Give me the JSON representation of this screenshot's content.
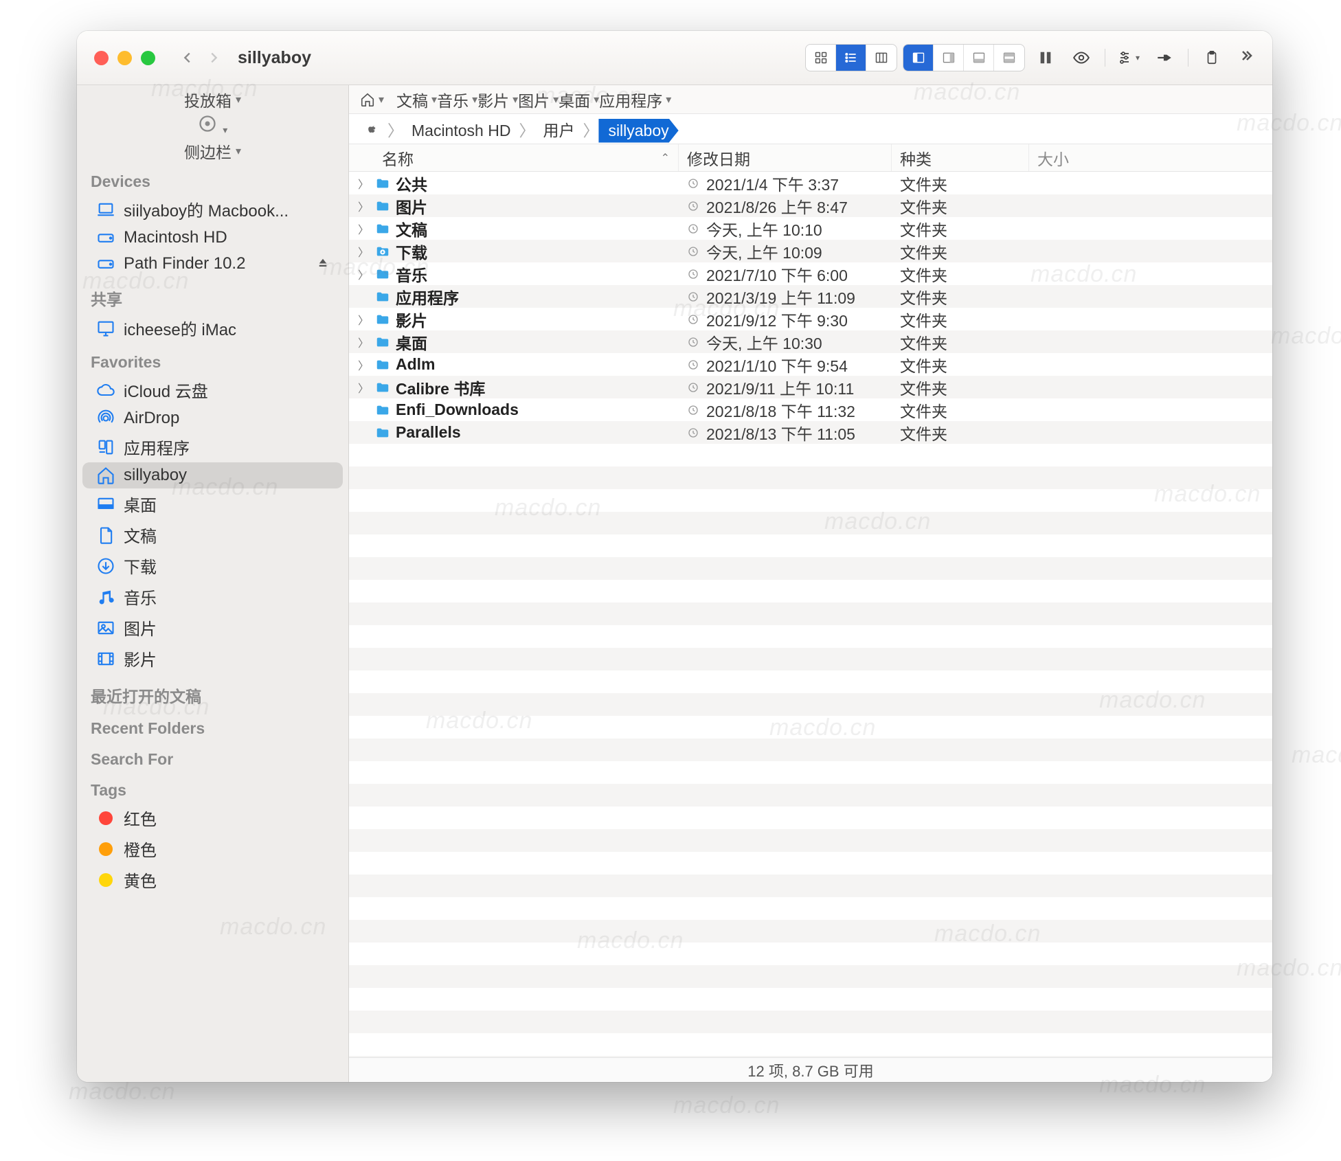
{
  "window": {
    "title": "sillyaboy"
  },
  "sidebar": {
    "top": {
      "dropbox": "投放箱",
      "sidebar_label": "侧边栏"
    },
    "sections": [
      {
        "label": "Devices",
        "items": [
          {
            "icon": "laptop",
            "text": "siilyaboy的 Macbook..."
          },
          {
            "icon": "drive",
            "text": "Macintosh HD"
          },
          {
            "icon": "drive",
            "text": "Path Finder 10.2",
            "eject": true
          }
        ]
      },
      {
        "label": "共享",
        "items": [
          {
            "icon": "display",
            "text": "icheese的 iMac"
          }
        ]
      },
      {
        "label": "Favorites",
        "items": [
          {
            "icon": "cloud",
            "text": "iCloud 云盘"
          },
          {
            "icon": "airdrop",
            "text": "AirDrop"
          },
          {
            "icon": "apps",
            "text": "应用程序"
          },
          {
            "icon": "home",
            "text": "sillyaboy",
            "selected": true
          },
          {
            "icon": "desktop",
            "text": "桌面"
          },
          {
            "icon": "doc",
            "text": "文稿"
          },
          {
            "icon": "download",
            "text": "下载"
          },
          {
            "icon": "music",
            "text": "音乐"
          },
          {
            "icon": "pictures",
            "text": "图片"
          },
          {
            "icon": "movies",
            "text": "影片"
          }
        ]
      },
      {
        "label": "最近打开的文稿",
        "items": []
      },
      {
        "label": "Recent Folders",
        "items": []
      },
      {
        "label": "Search For",
        "items": []
      },
      {
        "label": "Tags",
        "items": [
          {
            "icon": "tag",
            "color": "#ff453a",
            "text": "红色"
          },
          {
            "icon": "tag",
            "color": "#ff9f0a",
            "text": "橙色"
          },
          {
            "icon": "tag",
            "color": "#ffd60a",
            "text": "黄色"
          }
        ]
      }
    ]
  },
  "favbar": [
    "文稿",
    "音乐",
    "影片",
    "图片",
    "桌面",
    "应用程序"
  ],
  "pathbar": [
    "Macintosh HD",
    "用户",
    "sillyaboy"
  ],
  "columns": {
    "name": "名称",
    "date": "修改日期",
    "kind": "种类",
    "size": "大小"
  },
  "rows": [
    {
      "disc": true,
      "name": "公共",
      "date": "2021/1/4 下午 3:37",
      "kind": "文件夹"
    },
    {
      "disc": true,
      "name": "图片",
      "date": "2021/8/26 上午 8:47",
      "kind": "文件夹"
    },
    {
      "disc": true,
      "name": "文稿",
      "date": "今天, 上午 10:10",
      "kind": "文件夹"
    },
    {
      "disc": true,
      "name": "下载",
      "date": "今天, 上午 10:09",
      "kind": "文件夹",
      "iconVariant": "dl"
    },
    {
      "disc": true,
      "name": "音乐",
      "date": "2021/7/10 下午 6:00",
      "kind": "文件夹"
    },
    {
      "disc": false,
      "name": "应用程序",
      "date": "2021/3/19 上午 11:09",
      "kind": "文件夹"
    },
    {
      "disc": true,
      "name": "影片",
      "date": "2021/9/12 下午 9:30",
      "kind": "文件夹"
    },
    {
      "disc": true,
      "name": "桌面",
      "date": "今天, 上午 10:30",
      "kind": "文件夹"
    },
    {
      "disc": true,
      "name": "Adlm",
      "date": "2021/1/10 下午 9:54",
      "kind": "文件夹"
    },
    {
      "disc": true,
      "name": "Calibre 书库",
      "date": "2021/9/11 上午 10:11",
      "kind": "文件夹"
    },
    {
      "disc": false,
      "name": "Enfi_Downloads",
      "date": "2021/8/18 下午 11:32",
      "kind": "文件夹"
    },
    {
      "disc": false,
      "name": "Parallels",
      "date": "2021/8/13 下午 11:05",
      "kind": "文件夹"
    }
  ],
  "status": "12 项, 8.7 GB 可用",
  "watermark": "macdo.cn"
}
